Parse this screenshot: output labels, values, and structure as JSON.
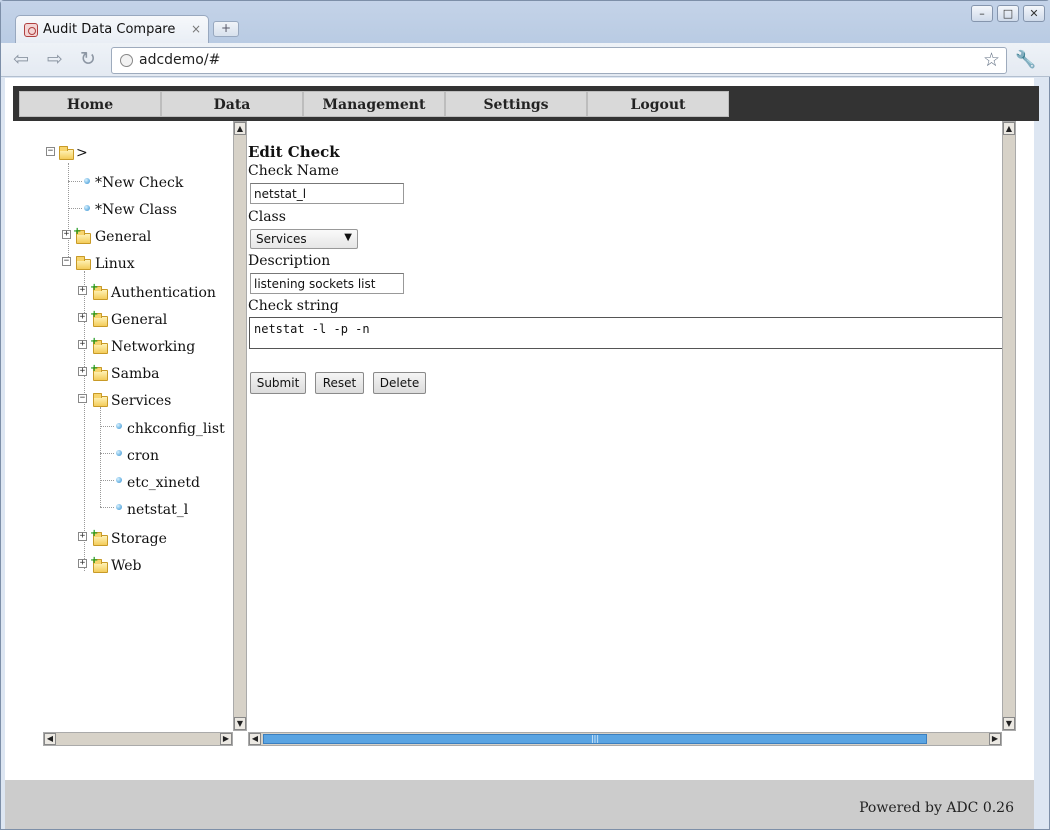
{
  "browser": {
    "tab_title": "Audit Data Compare",
    "tab_close": "×",
    "new_tab": "+",
    "url": "adcdemo/#",
    "window_buttons": [
      "–",
      "□",
      "✕"
    ]
  },
  "menu": {
    "items": [
      {
        "label": "Home"
      },
      {
        "label": "Data"
      },
      {
        "label": "Management"
      },
      {
        "label": "Settings"
      },
      {
        "label": "Logout"
      }
    ]
  },
  "tree": {
    "root": ">",
    "new_check": "*New Check",
    "new_class": "*New Class",
    "general": "General",
    "linux": "Linux",
    "linux_children": {
      "authentication": "Authentication",
      "general": "General",
      "networking": "Networking",
      "samba": "Samba",
      "services": "Services",
      "storage": "Storage",
      "web": "Web"
    },
    "services_children": [
      "chkconfig_list",
      "cron",
      "etc_xinetd",
      "netstat_l"
    ]
  },
  "form": {
    "title": "Edit Check",
    "check_name_label": "Check Name",
    "check_name_value": "netstat_l",
    "class_label": "Class",
    "class_value": "Services",
    "description_label": "Description",
    "description_value": "listening sockets list",
    "check_string_label": "Check string",
    "check_string_value": "netstat -l -p -n",
    "submit_label": "Submit",
    "reset_label": "Reset",
    "delete_label": "Delete"
  },
  "footer": {
    "text": "Powered by ADC 0.26"
  },
  "icons": {
    "back": "back-arrow-icon",
    "forward": "forward-arrow-icon",
    "reload": "reload-icon",
    "bookmark": "star-icon",
    "settings": "wrench-icon",
    "folder": "folder-icon",
    "leaf": "leaf-bullet-icon"
  }
}
